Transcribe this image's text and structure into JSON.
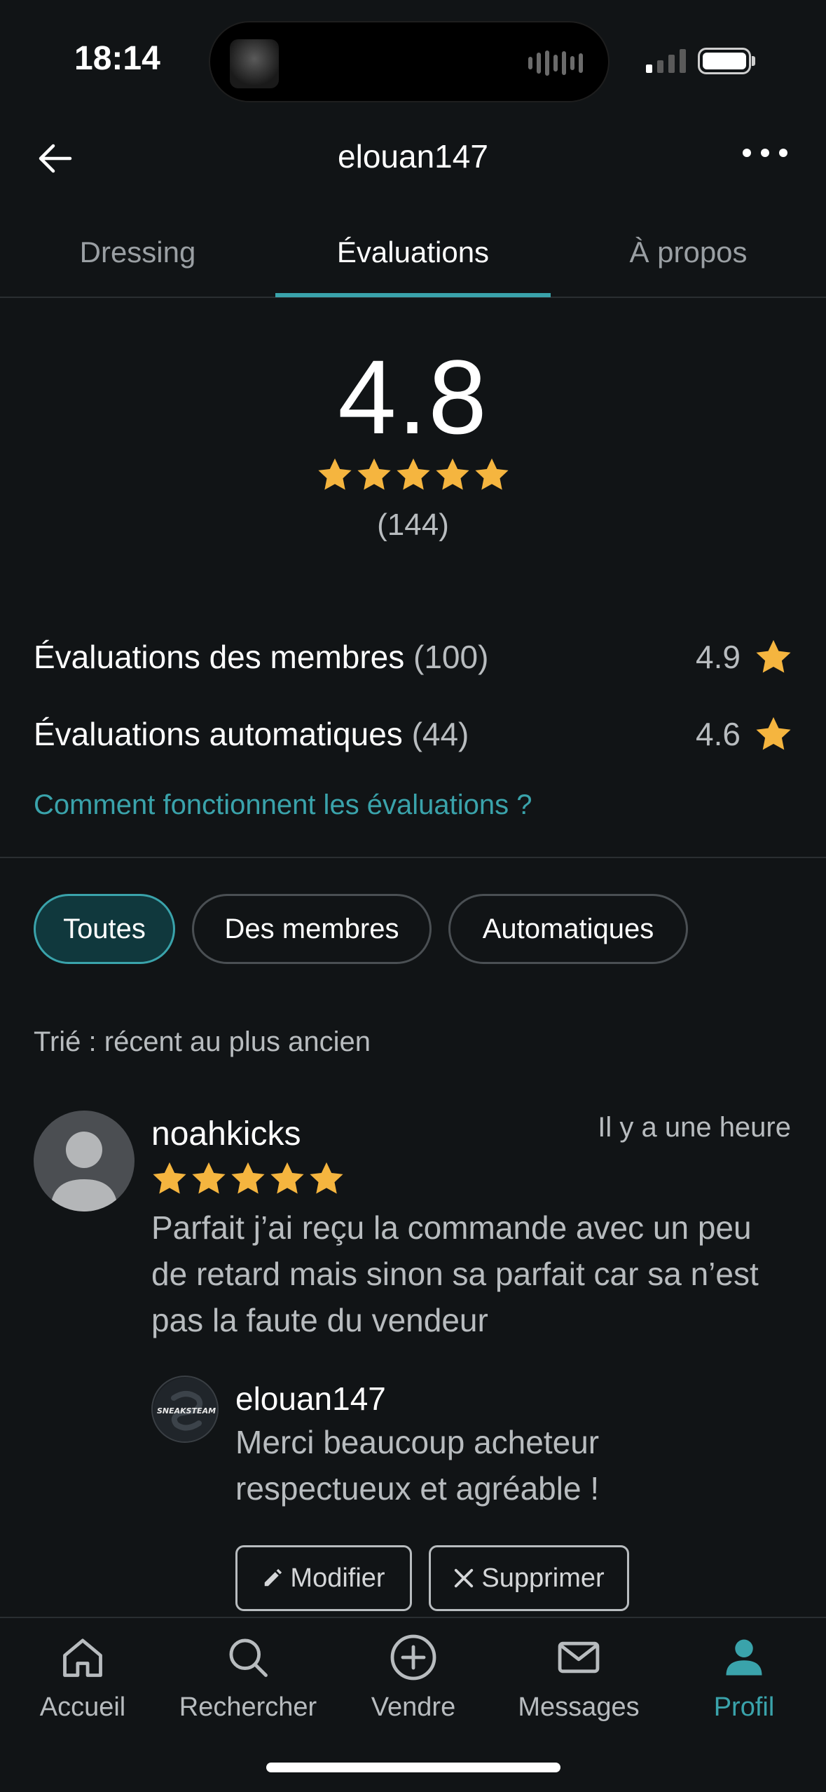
{
  "status_bar": {
    "time": "18:14"
  },
  "header": {
    "title": "elouan147"
  },
  "tabs": [
    {
      "label": "Dressing",
      "active": false
    },
    {
      "label": "Évaluations",
      "active": true
    },
    {
      "label": "À propos",
      "active": false
    }
  ],
  "summary": {
    "rating": "4.8",
    "stars": 5,
    "count": "(144)"
  },
  "breakdown": [
    {
      "label": "Évaluations des membres",
      "count": "(100)",
      "value": "4.9"
    },
    {
      "label": "Évaluations automatiques",
      "count": "(44)",
      "value": "4.6"
    }
  ],
  "how_link": "Comment fonctionnent les évaluations ?",
  "filters": [
    {
      "label": "Toutes",
      "active": true
    },
    {
      "label": "Des membres",
      "active": false
    },
    {
      "label": "Automatiques",
      "active": false
    }
  ],
  "sort_label": "Trié : récent au plus ancien",
  "review": {
    "author": "noahkicks",
    "time": "Il y a une heure",
    "stars": 5,
    "text": "Parfait j’ai reçu la commande avec un peu de retard mais sinon sa parfait car sa n’est pas la faute du vendeur",
    "reply": {
      "author": "elouan147",
      "avatar_text": "SNEAKSTEAM",
      "text": "Merci beaucoup acheteur respectueux et agréable !"
    },
    "actions": {
      "edit": "Modifier",
      "delete": "Supprimer"
    }
  },
  "nav": [
    {
      "label": "Accueil",
      "icon": "home-icon",
      "active": false
    },
    {
      "label": "Rechercher",
      "icon": "search-icon",
      "active": false
    },
    {
      "label": "Vendre",
      "icon": "plus-circle-icon",
      "active": false
    },
    {
      "label": "Messages",
      "icon": "envelope-icon",
      "active": false
    },
    {
      "label": "Profil",
      "icon": "person-icon",
      "active": true
    }
  ],
  "colors": {
    "accent": "#3aa3ab",
    "star": "#f5b53f",
    "background": "#111416"
  }
}
